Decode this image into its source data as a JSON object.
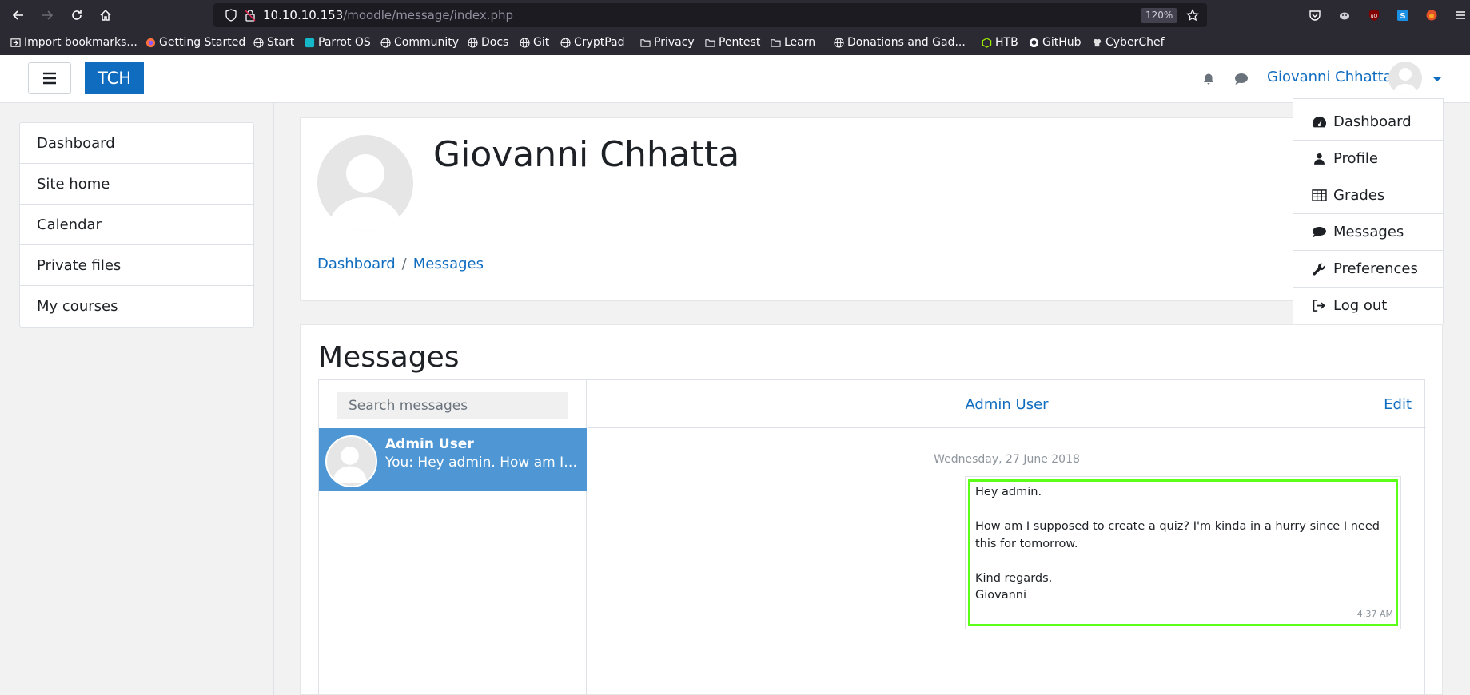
{
  "browser": {
    "url_host": "10.10.10.153",
    "url_path": "/moodle/message/index.php",
    "zoom": "120%",
    "bookmarks": [
      {
        "label": "Import bookmarks...",
        "icon": "import-icon"
      },
      {
        "label": "Getting Started",
        "icon": "firefox-icon"
      },
      {
        "label": "Start",
        "icon": "globe-icon"
      },
      {
        "label": "Parrot OS",
        "icon": "parrot-icon"
      },
      {
        "label": "Community",
        "icon": "globe-icon"
      },
      {
        "label": "Docs",
        "icon": "globe-icon"
      },
      {
        "label": "Git",
        "icon": "globe-icon"
      },
      {
        "label": "CryptPad",
        "icon": "globe-icon"
      },
      {
        "label": "Privacy",
        "icon": "folder-icon"
      },
      {
        "label": "Pentest",
        "icon": "folder-icon"
      },
      {
        "label": "Learn",
        "icon": "folder-icon"
      },
      {
        "label": "Donations and Gad...",
        "icon": "globe-icon"
      },
      {
        "label": "HTB",
        "icon": "htb-icon"
      },
      {
        "label": "GitHub",
        "icon": "github-icon"
      },
      {
        "label": "CyberChef",
        "icon": "chef-icon"
      }
    ]
  },
  "navbar": {
    "brand": "TCH",
    "user_name": "Giovanni Chhatta"
  },
  "drawer": {
    "items": [
      "Dashboard",
      "Site home",
      "Calendar",
      "Private files",
      "My courses"
    ]
  },
  "header": {
    "title": "Giovanni Chhatta",
    "breadcrumb": [
      "Dashboard",
      "Messages"
    ]
  },
  "messages": {
    "heading": "Messages",
    "search_placeholder": "Search messages",
    "contact": {
      "name": "Admin User",
      "preview": "You: Hey admin. How am I supposed to create a quiz?"
    },
    "conversation": {
      "title": "Admin User",
      "edit_label": "Edit",
      "date": "Wednesday, 27 June 2018",
      "lines": [
        "Hey admin.",
        "",
        "How am I supposed to create a quiz? I'm kinda in a hurry since I need this for tomorrow.",
        "",
        "Kind regards,",
        "Giovanni"
      ],
      "time": "4:37 AM"
    }
  },
  "user_menu": {
    "items": [
      {
        "label": "Dashboard",
        "icon": "dashboard-icon"
      },
      {
        "label": "Profile",
        "icon": "user-icon"
      },
      {
        "label": "Grades",
        "icon": "table-icon"
      },
      {
        "label": "Messages",
        "icon": "comment-icon"
      },
      {
        "label": "Preferences",
        "icon": "wrench-icon"
      },
      {
        "label": "Log out",
        "icon": "sign-out-icon"
      }
    ]
  },
  "colors": {
    "brand": "#0f6cbf",
    "selected_contact": "#4e97d4",
    "highlight": "#5bff18",
    "chrome_bg": "#2b2a33"
  }
}
